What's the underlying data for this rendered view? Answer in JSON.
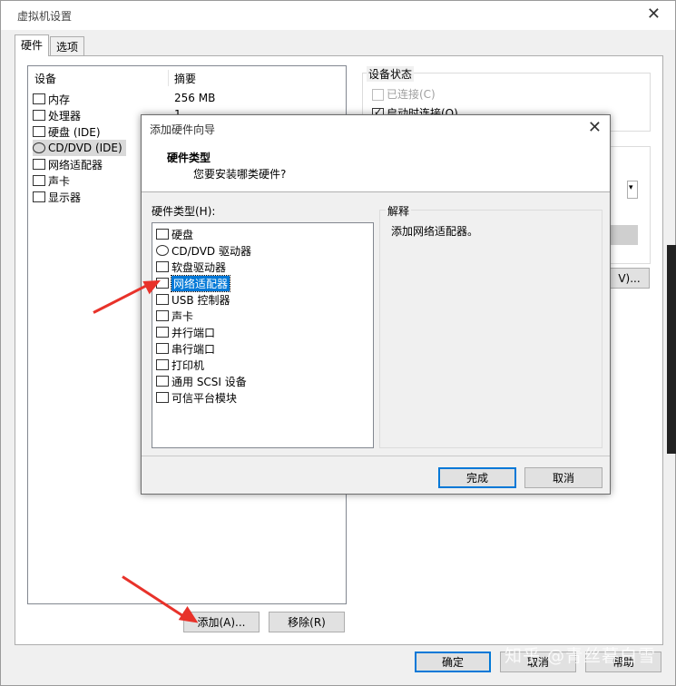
{
  "main_window": {
    "title": "虚拟机设置",
    "close_glyph": "✕",
    "tabs": [
      {
        "label": "硬件"
      },
      {
        "label": "选项"
      }
    ],
    "device_table": {
      "col_device": "设备",
      "col_summary": "摘要",
      "rows": [
        {
          "name": "内存",
          "summary": "256 MB",
          "icon": "memory-icon"
        },
        {
          "name": "处理器",
          "summary": "1",
          "icon": "cpu-icon"
        },
        {
          "name": "硬盘 (IDE)",
          "summary": "",
          "icon": "harddisk-icon"
        },
        {
          "name": "CD/DVD (IDE)",
          "summary": "",
          "icon": "cd-icon"
        },
        {
          "name": "网络适配器",
          "summary": "",
          "icon": "network-icon"
        },
        {
          "name": "声卡",
          "summary": "",
          "icon": "sound-icon"
        },
        {
          "name": "显示器",
          "summary": "",
          "icon": "monitor-icon"
        }
      ]
    },
    "device_status": {
      "label": "设备状态",
      "connected": "已连接(C)",
      "connect_on_power": "启动时连接(O)"
    },
    "partial_button": "V)...",
    "add_button": "添加(A)...",
    "remove_button": "移除(R)",
    "ok_button": "确定",
    "cancel_button": "取消",
    "help_button": "帮助"
  },
  "dialog": {
    "title": "添加硬件向导",
    "close_glyph": "✕",
    "header_title": "硬件类型",
    "header_subtitle": "您要安装哪类硬件?",
    "hw_type_label": "硬件类型(H):",
    "hw_items": [
      {
        "label": "硬盘",
        "icon": "harddisk-icon"
      },
      {
        "label": "CD/DVD 驱动器",
        "icon": "cd-icon"
      },
      {
        "label": "软盘驱动器",
        "icon": "floppy-icon"
      },
      {
        "label": "网络适配器",
        "icon": "network-icon",
        "selected": true
      },
      {
        "label": "USB 控制器",
        "icon": "usb-icon"
      },
      {
        "label": "声卡",
        "icon": "sound-icon"
      },
      {
        "label": "并行端口",
        "icon": "parallel-port-icon"
      },
      {
        "label": "串行端口",
        "icon": "serial-port-icon"
      },
      {
        "label": "打印机",
        "icon": "printer-icon"
      },
      {
        "label": "通用 SCSI 设备",
        "icon": "scsi-icon"
      },
      {
        "label": "可信平台模块",
        "icon": "tpm-icon"
      }
    ],
    "explain_label": "解释",
    "explain_text": "添加网络适配器。",
    "finish_button": "完成",
    "cancel_button": "取消"
  },
  "watermark": "知乎 @青丝暮白雪",
  "colors": {
    "accent": "#0078d7",
    "arrow": "#e8322a"
  }
}
